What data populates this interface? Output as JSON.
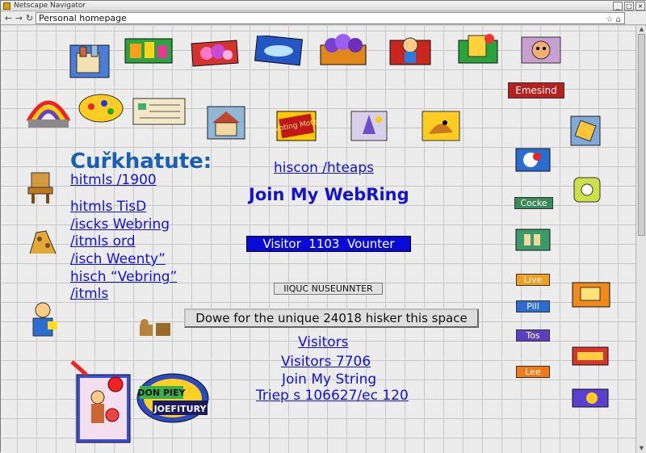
{
  "window": {
    "title": "Netscape Navigator"
  },
  "nav": {
    "address": "Personal homepage"
  },
  "left": {
    "heading": "Cuřkhatute:",
    "links": [
      "hitmls /1900",
      "hitmls TisD",
      "/iscks Webring",
      "/itmls ord",
      "/isch Weenty”",
      "hisch “Vebring”",
      "/itmls"
    ]
  },
  "center": {
    "top_link": "hiscon /hteaps",
    "webring": "Join My WebRing",
    "counter": "Visitor  1103  Vounter",
    "small_button": "IIQUC NUSEUNNTER",
    "big_button": "Dowe for the unique 24018 hisker this space",
    "visitors_link": "Visitors",
    "visitors_count": "Visitors 7706",
    "join_string": "Join My String",
    "trips_link": "Triep s 106627/ec 120"
  },
  "right_buttons": {
    "emesind": "Emesind",
    "cocke": "Cocke",
    "live": "Live",
    "pill": "Pill",
    "tos": "Tos",
    "lee": "Lee"
  },
  "clipart": {
    "voting_sign": "Voting Mote",
    "badge_line1": "DON PIEY",
    "badge_line2": "JOEFITURY"
  },
  "colors": {
    "link": "#1212d8",
    "heading": "#1a5fb0",
    "counter_bg": "#0a0ad8"
  }
}
